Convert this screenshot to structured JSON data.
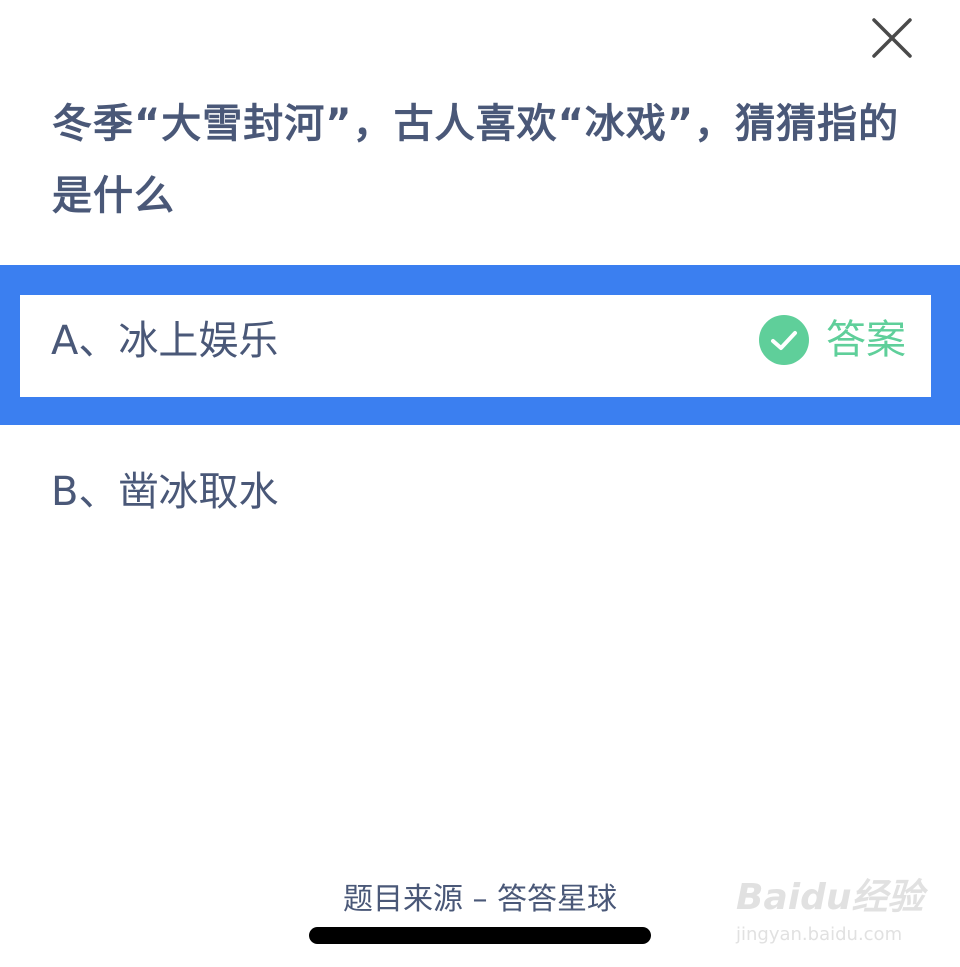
{
  "question": {
    "text": "冬季“大雪封河”，古人喜欢“冰戏”，猜猜指的是什么"
  },
  "options": [
    {
      "label": "A、冰上娱乐",
      "is_answer": true,
      "answer_label": "答案",
      "highlight_color": "#3b7ff0",
      "check_color": "#5fcf9a"
    },
    {
      "label": "B、凿冰取水",
      "is_answer": false
    }
  ],
  "footer": {
    "source": "题目来源 – 答答星球"
  },
  "watermark": {
    "logo_text": "Baidu经验",
    "url": "jingyan.baidu.com"
  },
  "icons": {
    "close": "close-icon",
    "check": "check-circle-icon"
  },
  "colors": {
    "text": "#4a5878",
    "accent": "#3b7ff0",
    "correct": "#5fcf9a"
  }
}
